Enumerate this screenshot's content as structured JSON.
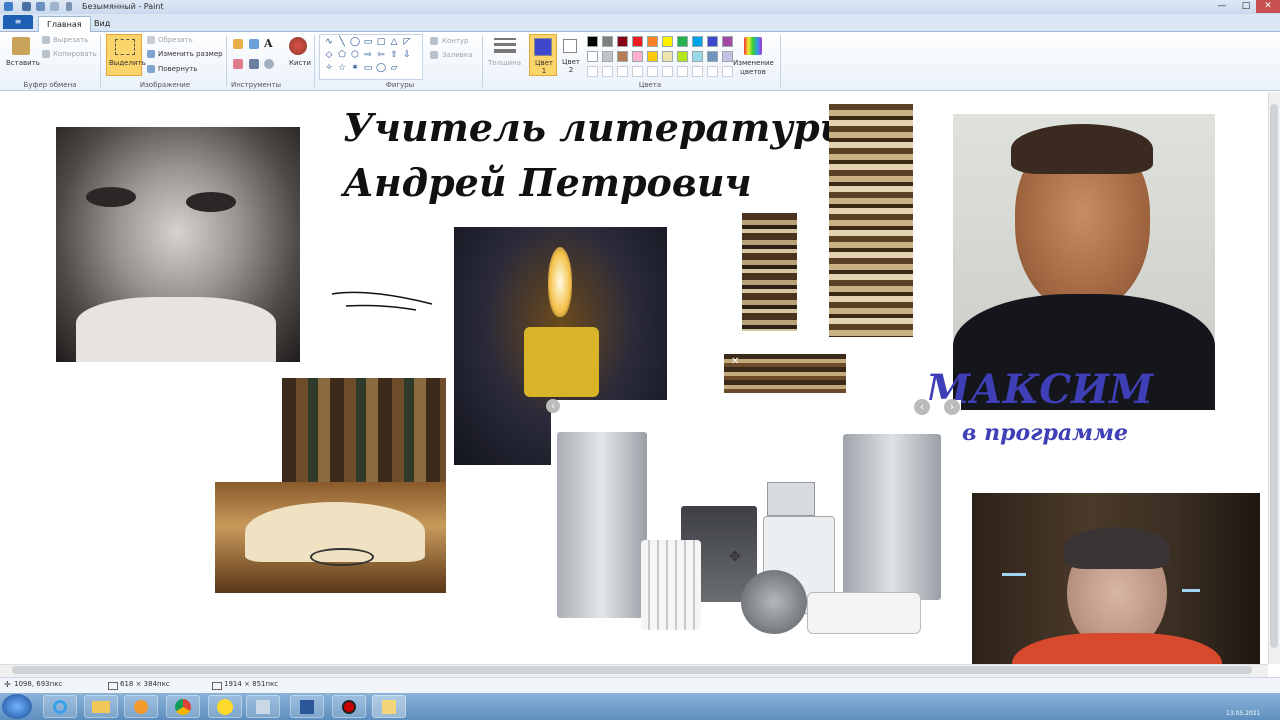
{
  "window": {
    "title": "Безымянный - Paint",
    "controls": {
      "minimize": "—",
      "maximize": "□",
      "close": "✕"
    }
  },
  "tabs": {
    "file": "≡",
    "home": "Главная",
    "view": "Вид"
  },
  "ribbon": {
    "clipboard": {
      "paste": "Вставить",
      "cut": "Вырезать",
      "copy": "Копировать",
      "group": "Буфер обмена"
    },
    "image": {
      "select": "Выделить",
      "crop": "Обрезать",
      "resize": "Изменить размер",
      "rotate": "Повернуть",
      "group": "Изображение"
    },
    "tools": {
      "group": "Инструменты",
      "text_tool": "A",
      "brushes": "Кисти"
    },
    "shapes": {
      "outline": "Контур",
      "fill": "Заливка",
      "group": "Фигуры",
      "glyphs": [
        "∿",
        "╲",
        "◯",
        "▭",
        "▢",
        "△",
        "◸",
        "◇",
        "⬠",
        "⬡",
        "⇨",
        "⇦",
        "⇧",
        "⇩",
        "✧",
        "☆",
        "✶",
        "▭",
        "◯",
        "▱"
      ]
    },
    "size": {
      "label": "Толщина"
    },
    "colors": {
      "color1": "Цвет 1",
      "color2": "Цвет 2",
      "edit": "Изменение цветов",
      "group": "Цвета",
      "color1_value": "#3f48cc",
      "color2_value": "#ffffff",
      "palette_row1": [
        "#000000",
        "#7f7f7f",
        "#880015",
        "#ed1c24",
        "#ff7f27",
        "#fff200",
        "#22b14c",
        "#00a2e8",
        "#3f48cc",
        "#a349a4"
      ],
      "palette_row2": [
        "#ffffff",
        "#c3c3c3",
        "#b97a57",
        "#ffaec9",
        "#ffc90e",
        "#efe4b0",
        "#b5e61d",
        "#99d9ea",
        "#7092be",
        "#c8bfe7"
      ]
    }
  },
  "canvas": {
    "title_line1": "Учитель литературы",
    "title_line2": "Андрей Петрович",
    "name": "МАКСИМ",
    "subtitle": "в программе",
    "close_mark": "✕",
    "nav_left": "‹",
    "nav_right": "›",
    "move_cursor": "✥"
  },
  "status": {
    "cursor_pos": "1098, 693пкс",
    "selection_size": "618 × 384пкс",
    "image_size": "1914 × 851пкс"
  },
  "taskbar": {
    "clock": "13.05.2021"
  }
}
